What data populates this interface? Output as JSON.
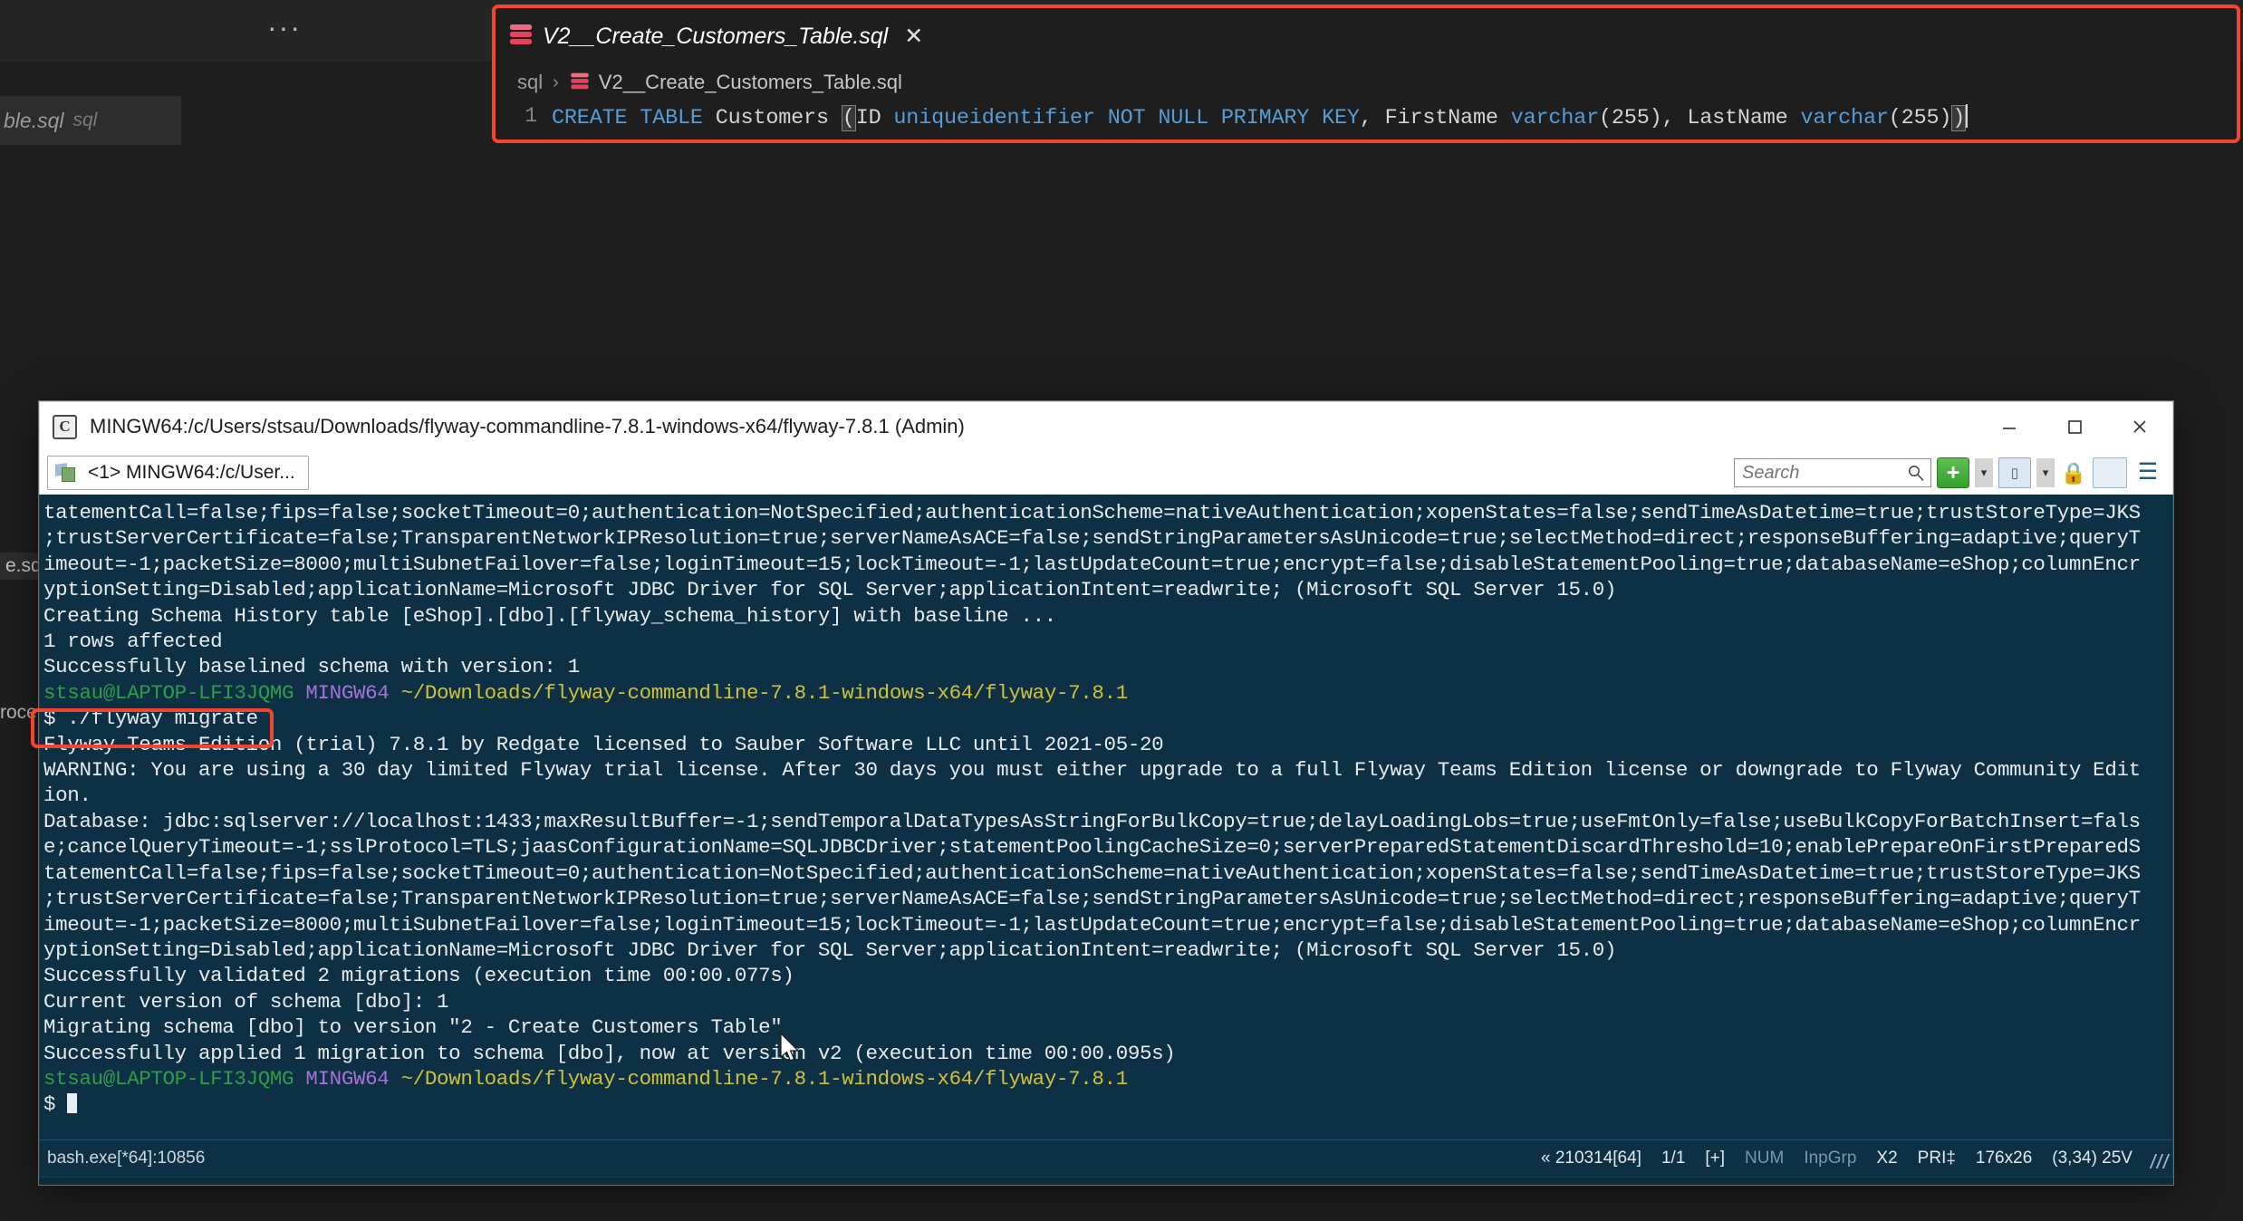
{
  "editor": {
    "overflow_menu": "···",
    "inactive_tab": {
      "label": "ble.sql",
      "ext": "sql"
    },
    "fragments": {
      "left1": "e.sq",
      "left2": "roce"
    },
    "tab": {
      "title": "V2__Create_Customers_Table.sql",
      "close": "✕",
      "icon": "sql-file-icon"
    },
    "breadcrumb": {
      "folder": "sql",
      "separator": "›",
      "file": "V2__Create_Customers_Table.sql"
    },
    "code": {
      "line_number": "1",
      "tokens": [
        {
          "t": "CREATE",
          "c": "kw"
        },
        {
          "t": " ",
          "c": "punct"
        },
        {
          "t": "TABLE",
          "c": "kw"
        },
        {
          "t": " Customers ",
          "c": "id"
        },
        {
          "t": "(",
          "c": "brkt"
        },
        {
          "t": "ID ",
          "c": "id"
        },
        {
          "t": "uniqueidentifier",
          "c": "kw"
        },
        {
          "t": " ",
          "c": "punct"
        },
        {
          "t": "NOT",
          "c": "kw"
        },
        {
          "t": " ",
          "c": "punct"
        },
        {
          "t": "NULL",
          "c": "kw"
        },
        {
          "t": " ",
          "c": "punct"
        },
        {
          "t": "PRIMARY",
          "c": "kw"
        },
        {
          "t": " ",
          "c": "punct"
        },
        {
          "t": "KEY",
          "c": "kw"
        },
        {
          "t": ", FirstName ",
          "c": "id"
        },
        {
          "t": "varchar",
          "c": "kw"
        },
        {
          "t": "(255), LastName ",
          "c": "id"
        },
        {
          "t": "varchar",
          "c": "kw"
        },
        {
          "t": "(255)",
          "c": "id"
        },
        {
          "t": ")",
          "c": "brkt"
        }
      ],
      "plain": "CREATE TABLE Customers (ID uniqueidentifier NOT NULL PRIMARY KEY, FirstName varchar(255), LastName varchar(255))"
    },
    "highlight_color": "#f4442e"
  },
  "terminal_window": {
    "title": "MINGW64:/c/Users/stsau/Downloads/flyway-commandline-7.8.1-windows-x64/flyway-7.8.1 (Admin)",
    "window_icon": "mintty-icon",
    "buttons": {
      "minimize": "—",
      "maximize": "☐",
      "close": "✕"
    },
    "tab": {
      "label": "<1> MINGW64:/c/User...",
      "icon": "terminal-tab-icon"
    },
    "toolbar": {
      "search_placeholder": "Search",
      "search_value": "",
      "search_icon": "magnifier-icon",
      "new_tab": "+",
      "new_tab_caret": "▾",
      "window_icon": "window-icon",
      "window_caret": "▾",
      "lock_icon": "lock-icon",
      "split_icon": "split-pane-icon",
      "menu_icon": "hamburger-menu-icon"
    },
    "lines": [
      {
        "text": "tatementCall=false;fips=false;socketTimeout=0;authentication=NotSpecified;authenticationScheme=nativeAuthentication;xopenStates=false;sendTimeAsDatetime=true;trustStoreType=JKS",
        "style": "white"
      },
      {
        "text": ";trustServerCertificate=false;TransparentNetworkIPResolution=true;serverNameAsACE=false;sendStringParametersAsUnicode=true;selectMethod=direct;responseBuffering=adaptive;queryT",
        "style": "white"
      },
      {
        "text": "imeout=-1;packetSize=8000;multiSubnetFailover=false;loginTimeout=15;lockTimeout=-1;lastUpdateCount=true;encrypt=false;disableStatementPooling=true;databaseName=eShop;columnEncr",
        "style": "white"
      },
      {
        "text": "yptionSetting=Disabled;applicationName=Microsoft JDBC Driver for SQL Server;applicationIntent=readwrite; (Microsoft SQL Server 15.0)",
        "style": "white"
      },
      {
        "text": "Creating Schema History table [eShop].[dbo].[flyway_schema_history] with baseline ...",
        "style": "white"
      },
      {
        "text": "1 rows affected",
        "style": "white"
      },
      {
        "text": "Successfully baselined schema with version: 1",
        "style": "white"
      },
      {
        "text": "",
        "style": "white"
      },
      {
        "text": "",
        "style": "prompt1"
      },
      {
        "text": "$ ./flyway migrate",
        "style": "white"
      },
      {
        "text": "Flyway Teams Edition (trial) 7.8.1 by Redgate licensed to Sauber Software LLC until 2021-05-20",
        "style": "white"
      },
      {
        "text": "WARNING: You are using a 30 day limited Flyway trial license. After 30 days you must either upgrade to a full Flyway Teams Edition license or downgrade to Flyway Community Edit",
        "style": "white"
      },
      {
        "text": "ion.",
        "style": "white"
      },
      {
        "text": "Database: jdbc:sqlserver://localhost:1433;maxResultBuffer=-1;sendTemporalDataTypesAsStringForBulkCopy=true;delayLoadingLobs=true;useFmtOnly=false;useBulkCopyForBatchInsert=fals",
        "style": "white"
      },
      {
        "text": "e;cancelQueryTimeout=-1;sslProtocol=TLS;jaasConfigurationName=SQLJDBCDriver;statementPoolingCacheSize=0;serverPreparedStatementDiscardThreshold=10;enablePrepareOnFirstPreparedS",
        "style": "white"
      },
      {
        "text": "tatementCall=false;fips=false;socketTimeout=0;authentication=NotSpecified;authenticationScheme=nativeAuthentication;xopenStates=false;sendTimeAsDatetime=true;trustStoreType=JKS",
        "style": "white"
      },
      {
        "text": ";trustServerCertificate=false;TransparentNetworkIPResolution=true;serverNameAsACE=false;sendStringParametersAsUnicode=true;selectMethod=direct;responseBuffering=adaptive;queryT",
        "style": "white"
      },
      {
        "text": "imeout=-1;packetSize=8000;multiSubnetFailover=false;loginTimeout=15;lockTimeout=-1;lastUpdateCount=true;encrypt=false;disableStatementPooling=true;databaseName=eShop;columnEncr",
        "style": "white"
      },
      {
        "text": "yptionSetting=Disabled;applicationName=Microsoft JDBC Driver for SQL Server;applicationIntent=readwrite; (Microsoft SQL Server 15.0)",
        "style": "white"
      },
      {
        "text": "Successfully validated 2 migrations (execution time 00:00.077s)",
        "style": "white"
      },
      {
        "text": "Current version of schema [dbo]: 1",
        "style": "white"
      },
      {
        "text": "Migrating schema [dbo] to version \"2 - Create Customers Table\"",
        "style": "white"
      },
      {
        "text": "Successfully applied 1 migration to schema [dbo], now at version v2 (execution time 00:00.095s)",
        "style": "white"
      },
      {
        "text": "",
        "style": "white"
      },
      {
        "text": "",
        "style": "prompt2"
      },
      {
        "text": "$ ",
        "style": "white"
      }
    ],
    "prompt": {
      "user_host": "stsau@LAPTOP-LFI3JQMG",
      "shell": "MINGW64",
      "path": "~/Downloads/flyway-commandline-7.8.1-windows-x64/flyway-7.8.1",
      "symbol": "$"
    },
    "command_highlighted": "$ ./flyway migrate",
    "status_bar": {
      "left": "bash.exe[*64]:10856",
      "items": [
        "« 210314[64]",
        "1/1",
        "[+]",
        "NUM",
        "InpGrp",
        "X2",
        "PRI‡",
        "176x26",
        "(3,34) 25V"
      ]
    }
  }
}
